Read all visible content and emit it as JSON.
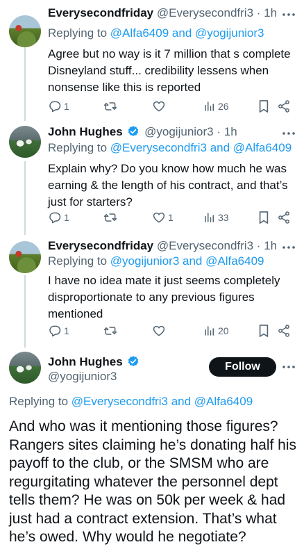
{
  "tweets": [
    {
      "name": "Everysecondfriday",
      "handle": "@Everysecondfri3",
      "time": "· 1h",
      "replying_prefix": "Replying to",
      "replying_user1": "@Alfa6409",
      "replying_and": "and",
      "replying_user2": "@yogijunior3",
      "text": "Agree but no way is it 7 million that s complete Disneyland stuff... credibility lessens when nonsense like this is reported",
      "replies": "1",
      "retweets": "",
      "likes": "",
      "views": "26"
    },
    {
      "name": "John Hughes",
      "handle": "@yogijunior3",
      "time": "· 1h",
      "replying_prefix": "Replying to",
      "replying_user1": "@Everysecondfri3",
      "replying_and": "and",
      "replying_user2": "@Alfa6409",
      "text": "Explain why? Do you know how much he was earning & the length of his contract, and that’s just for starters?",
      "replies": "1",
      "retweets": "",
      "likes": "1",
      "views": "33"
    },
    {
      "name": "Everysecondfriday",
      "handle": "@Everysecondfri3",
      "time": "· 1h",
      "replying_prefix": "Replying to",
      "replying_user1": "@yogijunior3",
      "replying_and": "and",
      "replying_user2": "@Alfa6409",
      "text": "I have no idea mate it just seems completely disproportionate to any previous figures mentioned",
      "replies": "1",
      "retweets": "",
      "likes": "",
      "views": "20"
    }
  ],
  "main": {
    "name": "John Hughes",
    "handle": "@yogijunior3",
    "follow_label": "Follow",
    "replying_prefix": "Replying to",
    "replying_user1": "@Everysecondfri3",
    "replying_and": "and",
    "replying_user2": "@Alfa6409",
    "text": "And who was it mentioning those figures? Rangers sites claiming he’s donating half his payoff to the club, or the SMSM who are regurgitating whatever the personnel dept tells them? He was on 50k per week & had just had a contract extension. That’s what he’s owed. Why would he negotiate?"
  },
  "colors": {
    "accent": "#1d9bf0",
    "text": "#0f1419",
    "muted": "#536471",
    "line": "#cfd9de"
  },
  "icons": [
    "more-icon",
    "reply-icon",
    "retweet-icon",
    "like-icon",
    "views-icon",
    "bookmark-icon",
    "share-icon",
    "verified-icon"
  ]
}
